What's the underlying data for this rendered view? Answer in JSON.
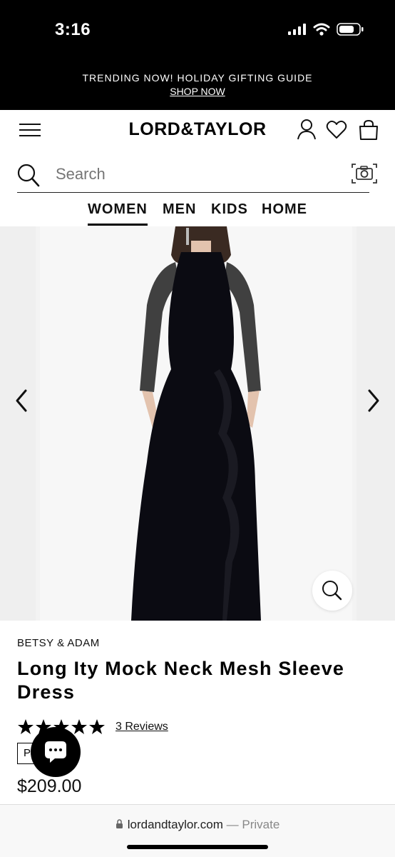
{
  "status_bar": {
    "time": "3:16"
  },
  "promo": {
    "text": "TRENDING NOW! HOLIDAY GIFTING GUIDE",
    "link": "SHOP NOW"
  },
  "header": {
    "logo": "LORD&TAYLOR"
  },
  "search": {
    "placeholder": "Search"
  },
  "nav": {
    "tabs": [
      "WOMEN",
      "MEN",
      "KIDS",
      "HOME"
    ],
    "active": "WOMEN"
  },
  "product": {
    "brand": "BETSY & ADAM",
    "title": "Long Ity Mock Neck Mesh Sleeve Dress",
    "rating": 5,
    "reviews_link": "3 Reviews",
    "badge_letter": "P",
    "price": "$209.00"
  },
  "browser": {
    "domain": "lordandtaylor.com",
    "mode": "— Private"
  },
  "icons": [
    "signal-icon",
    "wifi-icon",
    "battery-icon",
    "menu-icon",
    "account-icon",
    "heart-icon",
    "bag-icon",
    "search-icon",
    "camera-icon",
    "chevron-left-icon",
    "chevron-right-icon",
    "zoom-icon",
    "star-icon",
    "chat-icon",
    "lock-icon"
  ],
  "colors": {
    "bar": "#000000",
    "accent": "#000000",
    "background": "#ffffff"
  }
}
